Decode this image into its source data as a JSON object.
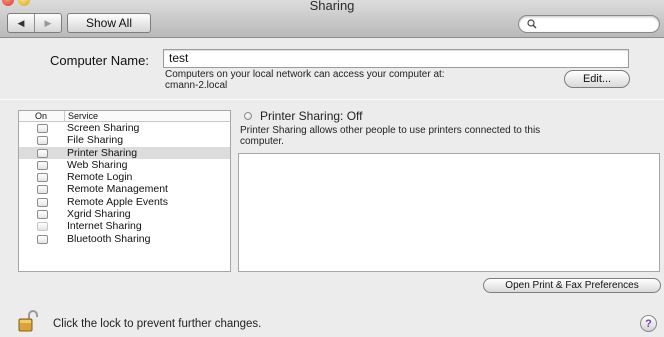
{
  "window": {
    "title": "Sharing"
  },
  "toolbar": {
    "back_glyph": "◀",
    "forward_glyph": "▶",
    "show_all_label": "Show All",
    "search_icon": "search-icon",
    "search_value": ""
  },
  "computer_name": {
    "label": "Computer Name:",
    "value": "test",
    "note_line1": "Computers on your local network can access your computer at:",
    "note_line2": "cmann-2.local",
    "edit_label": "Edit..."
  },
  "service_list": {
    "col_on": "On",
    "col_service": "Service",
    "items": [
      {
        "label": "Screen Sharing",
        "checked": false,
        "selected": false
      },
      {
        "label": "File Sharing",
        "checked": false,
        "selected": false
      },
      {
        "label": "Printer Sharing",
        "checked": false,
        "selected": true
      },
      {
        "label": "Web Sharing",
        "checked": false,
        "selected": false
      },
      {
        "label": "Remote Login",
        "checked": false,
        "selected": false
      },
      {
        "label": "Remote Management",
        "checked": false,
        "selected": false
      },
      {
        "label": "Remote Apple Events",
        "checked": false,
        "selected": false
      },
      {
        "label": "Xgrid Sharing",
        "checked": false,
        "selected": false
      },
      {
        "label": "Internet Sharing",
        "checked": false,
        "selected": false,
        "dimmed": true
      },
      {
        "label": "Bluetooth Sharing",
        "checked": false,
        "selected": false
      }
    ]
  },
  "detail": {
    "status": "Printer Sharing: Off",
    "description_line1": "Printer Sharing allows other people to use printers connected to this",
    "description_line2": "computer.",
    "open_prefs_label": "Open Print & Fax Preferences"
  },
  "footer": {
    "lock_icon": "lock-open-icon",
    "lock_text": "Click the lock to prevent further changes.",
    "help_label": "?"
  }
}
